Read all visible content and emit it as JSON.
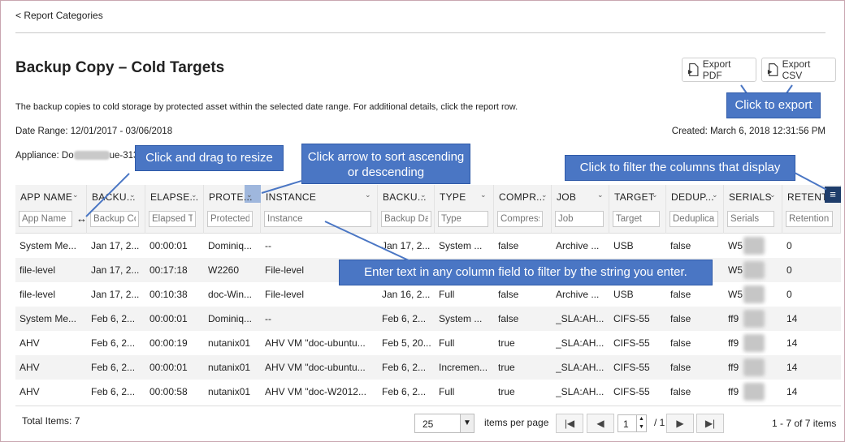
{
  "nav": {
    "back_label": "< Report Categories"
  },
  "page": {
    "title": "Backup Copy – Cold Targets",
    "description": "The backup copies to cold storage by protected asset within the selected date range. For additional details, click the report row.",
    "date_range": "Date Range: 12/01/2017 - 03/06/2018",
    "created": "Created: March 6, 2018 12:31:56 PM",
    "appliance_prefix": "Appliance: Do",
    "appliance_suffix": "ue-313"
  },
  "export": {
    "pdf_label": "Export PDF",
    "csv_label": "Export CSV"
  },
  "columns": [
    {
      "title": "APP NAME",
      "placeholder": "App Name"
    },
    {
      "title": "BACKU...",
      "placeholder": "Backup Co"
    },
    {
      "title": "ELAPSE...",
      "placeholder": "Elapsed Ti"
    },
    {
      "title": "PROTE...",
      "placeholder": "Protected"
    },
    {
      "title": "INSTANCE",
      "placeholder": "Instance"
    },
    {
      "title": "BACKU...",
      "placeholder": "Backup Da"
    },
    {
      "title": "TYPE",
      "placeholder": "Type"
    },
    {
      "title": "COMPR...",
      "placeholder": "Compress"
    },
    {
      "title": "JOB",
      "placeholder": "Job"
    },
    {
      "title": "TARGET",
      "placeholder": "Target"
    },
    {
      "title": "DEDUP...",
      "placeholder": "Deduplica"
    },
    {
      "title": "SERIALS",
      "placeholder": "Serials"
    },
    {
      "title": "RETENT",
      "placeholder": "Retention"
    }
  ],
  "rows": [
    [
      "System Me...",
      "Jan 17, 2...",
      "00:00:01",
      "Dominiq...",
      "--",
      "Jan 17, 2...",
      "System ...",
      "false",
      "Archive ...",
      "USB",
      "false",
      "W5",
      "0"
    ],
    [
      "file-level",
      "Jan 17, 2...",
      "00:17:18",
      "W2260",
      "File-level",
      "",
      "",
      "",
      "",
      "",
      "",
      "W5",
      "0"
    ],
    [
      "file-level",
      "Jan 17, 2...",
      "00:10:38",
      "doc-Win...",
      "File-level",
      "Jan 16, 2...",
      "Full",
      "false",
      "Archive ...",
      "USB",
      "false",
      "W5",
      "0"
    ],
    [
      "System Me...",
      "Feb 6, 2...",
      "00:00:01",
      "Dominiq...",
      "--",
      "Feb 6, 2...",
      "System ...",
      "false",
      "_SLA:AH...",
      "CIFS-55",
      "false",
      "ff9",
      "14"
    ],
    [
      "AHV",
      "Feb 6, 2...",
      "00:00:19",
      "nutanix01",
      "AHV VM \"doc-ubuntu...",
      "Feb 5, 20...",
      "Full",
      "true",
      "_SLA:AH...",
      "CIFS-55",
      "false",
      "ff9",
      "14"
    ],
    [
      "AHV",
      "Feb 6, 2...",
      "00:00:01",
      "nutanix01",
      "AHV VM \"doc-ubuntu...",
      "Feb 6, 2...",
      "Incremen...",
      "true",
      "_SLA:AH...",
      "CIFS-55",
      "false",
      "ff9",
      "14"
    ],
    [
      "AHV",
      "Feb 6, 2...",
      "00:00:58",
      "nutanix01",
      "AHV VM \"doc-W2012...",
      "Feb 6, 2...",
      "Full",
      "true",
      "_SLA:AH...",
      "CIFS-55",
      "false",
      "ff9",
      "14"
    ]
  ],
  "footer": {
    "total_items": "Total Items: 7",
    "page_size": "25",
    "items_per_page": "items per page",
    "current_page": "1",
    "of_pages": "/ 1",
    "items_info": "1 - 7 of 7 items"
  },
  "pager_icons": [
    "first-page-icon",
    "prev-page-icon",
    "next-page-icon",
    "last-page-icon"
  ],
  "callouts": {
    "export": "Click to export",
    "resize": "Click and drag to resize",
    "sort": "Click arrow to sort ascending or descending",
    "filter_cols": "Click to filter the columns that display",
    "filter_text": "Enter text in any column field to filter by the string you enter."
  },
  "colors": {
    "callout": "#4a76c4",
    "menu_button": "#1f3d6b",
    "alt_row": "#f3f3f3"
  }
}
